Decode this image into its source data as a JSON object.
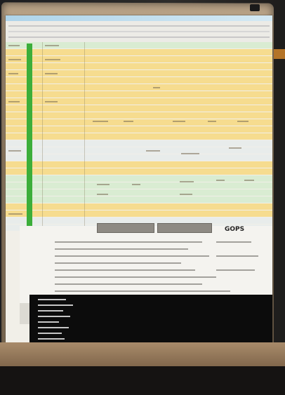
{
  "scene": {
    "logo_text": "GOPS"
  },
  "buttons": {
    "left": "",
    "right": ""
  }
}
